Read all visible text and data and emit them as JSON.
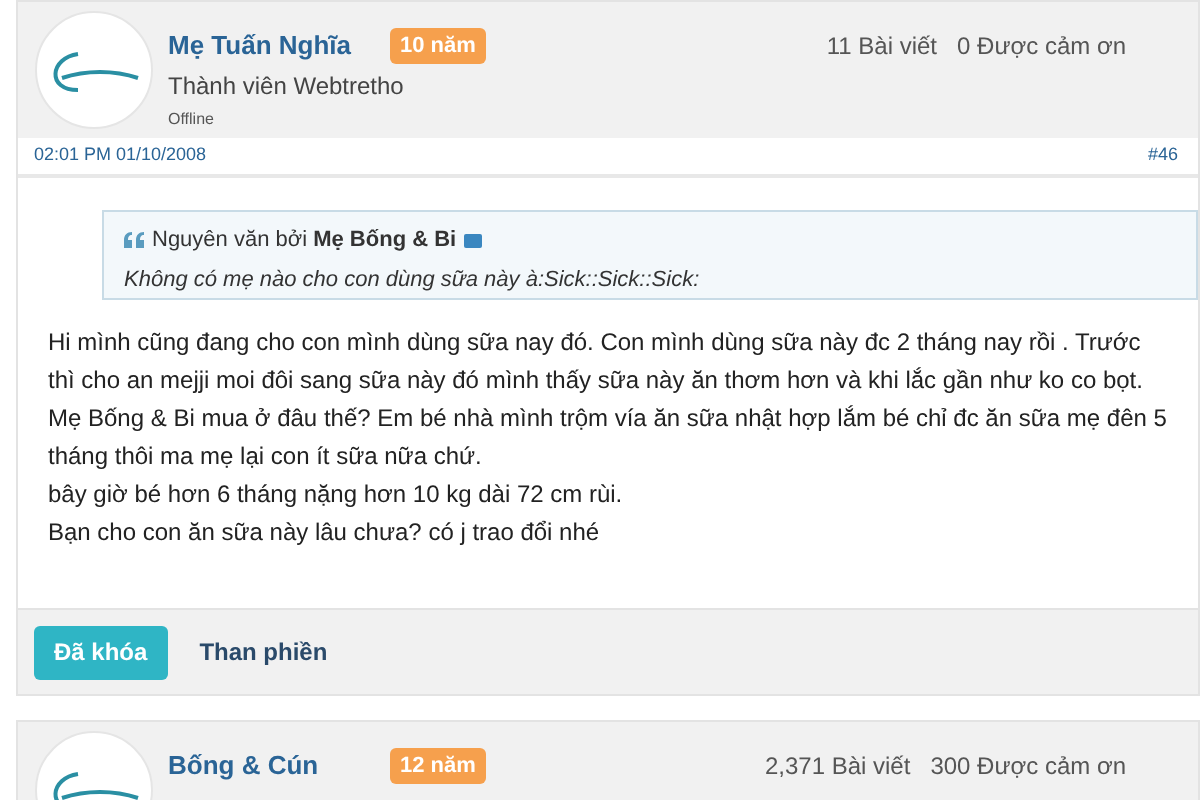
{
  "posts": [
    {
      "author": "Mẹ Tuấn Nghĩa",
      "badge": "10 năm",
      "role": "Thành viên Webtretho",
      "online_status": "Offline",
      "stats": [
        "11 Bài viết",
        "0 Được cảm ơn"
      ],
      "date": "02:01 PM 01/10/2008",
      "post_number": "#46",
      "quote": {
        "prefix": "Nguyên văn bởi",
        "author": "Mẹ Bống & Bi",
        "text": "Không có mẹ nào cho con dùng sữa này à:Sick::Sick::Sick:"
      },
      "body": [
        "Hi mình cũng đang cho con mình dùng sữa nay đó. Con mình dùng sữa này đc 2 tháng nay rồi . Trước thì cho an mejji moi đôi sang sữa này đó mình thấy sữa này ăn thơm hơn và khi lắc gần như ko co bọt. Mẹ Bống & Bi mua ở đâu thế? Em bé nhà mình trộm vía ăn sữa nhật hợp lắm bé chỉ đc ăn sữa mẹ đên 5 tháng thôi ma mẹ lại con ít sữa nữa chứ.",
        "bây giờ bé hơn 6 tháng nặng hơn 10 kg dài 72 cm rùi.",
        "Bạn cho con ăn sữa này lâu chưa? có j trao đổi nhé"
      ],
      "buttons": [
        {
          "label": "Đã khóa",
          "kind": "primary"
        },
        {
          "label": "Than phiền",
          "kind": "plain"
        }
      ]
    },
    {
      "author": "Bống & Cún",
      "badge": "12 năm",
      "stats": [
        "2,371 Bài viết",
        "300 Được cảm ơn"
      ]
    }
  ]
}
